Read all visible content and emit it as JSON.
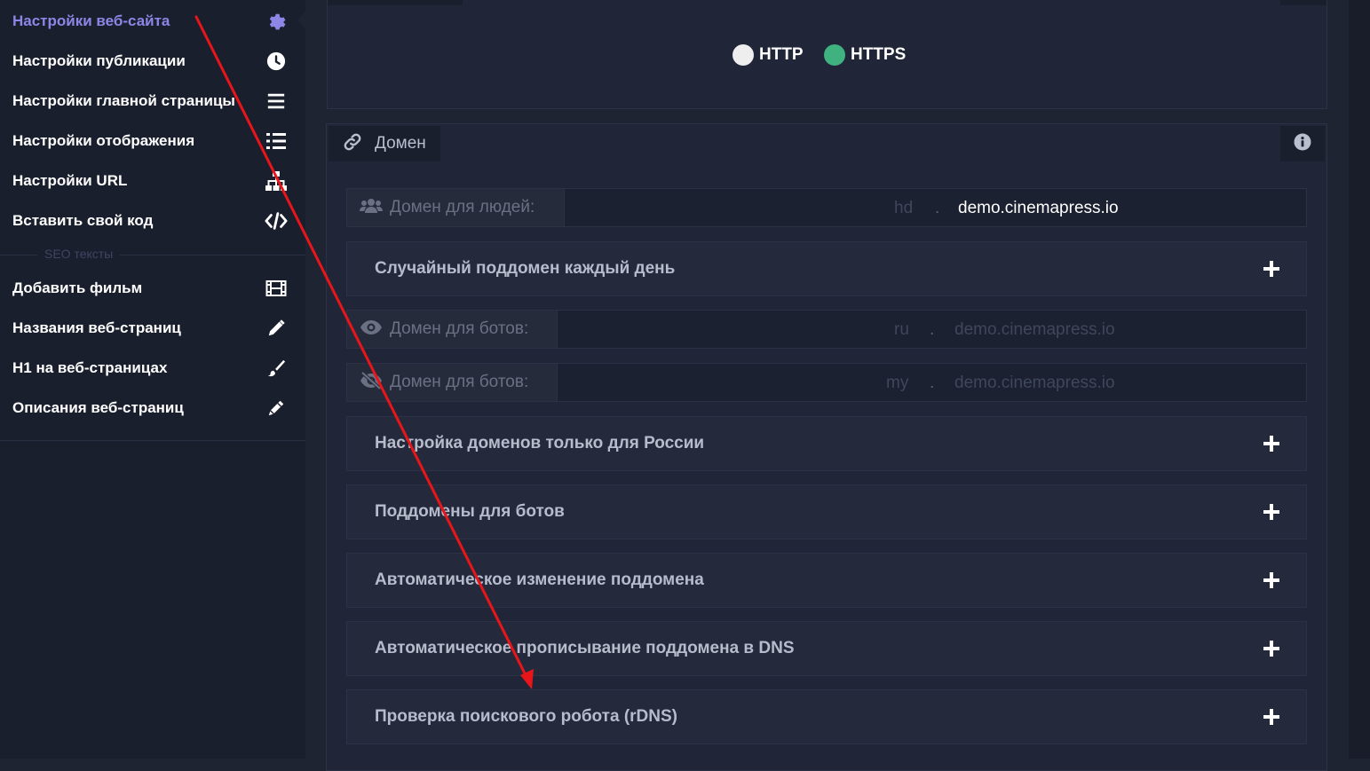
{
  "sidebar": {
    "items": [
      {
        "label": "Настройки веб-сайта",
        "icon": "gear-icon"
      },
      {
        "label": "Настройки публикации",
        "icon": "clock-icon"
      },
      {
        "label": "Настройки главной страницы",
        "icon": "bars-icon"
      },
      {
        "label": "Настройки отображения",
        "icon": "list-icon"
      },
      {
        "label": "Настройки URL",
        "icon": "sitemap-icon"
      },
      {
        "label": "Вставить свой код",
        "icon": "code-icon"
      }
    ],
    "seo_separator": "SEO тексты",
    "seo_items": [
      {
        "label": "Добавить фильм",
        "icon": "film-icon"
      },
      {
        "label": "Названия веб-страниц",
        "icon": "pencil-icon"
      },
      {
        "label": "H1 на веб-страницах",
        "icon": "brush-icon"
      },
      {
        "label": "Описания веб-страниц",
        "icon": "pen-icon"
      }
    ]
  },
  "protocol": {
    "http_label": "HTTP",
    "https_label": "HTTPS",
    "selected": "HTTPS"
  },
  "domain_panel": {
    "title": "Домен",
    "human_domain": {
      "label": "Домен для людей:",
      "subdomain": "hd",
      "separator": ".",
      "domain": "demo.cinemapress.io"
    },
    "random_subdomain": "Случайный поддомен каждый день",
    "bot_domain_1": {
      "label": "Домен для ботов:",
      "subdomain": "ru",
      "separator": ".",
      "domain": "demo.cinemapress.io"
    },
    "bot_domain_2": {
      "label": "Домен для ботов:",
      "subdomain": "my",
      "separator": ".",
      "domain": "demo.cinemapress.io"
    },
    "sections": [
      "Настройка доменов только для России",
      "Поддомены для ботов",
      "Автоматическое изменение поддомена",
      "Автоматическое прописывание поддомена в DNS",
      "Проверка поискового робота (rDNS)"
    ]
  },
  "colors": {
    "active_accent": "#8e86e6",
    "https_green": "#3fb27f",
    "annotation_arrow": "#e8161b"
  }
}
